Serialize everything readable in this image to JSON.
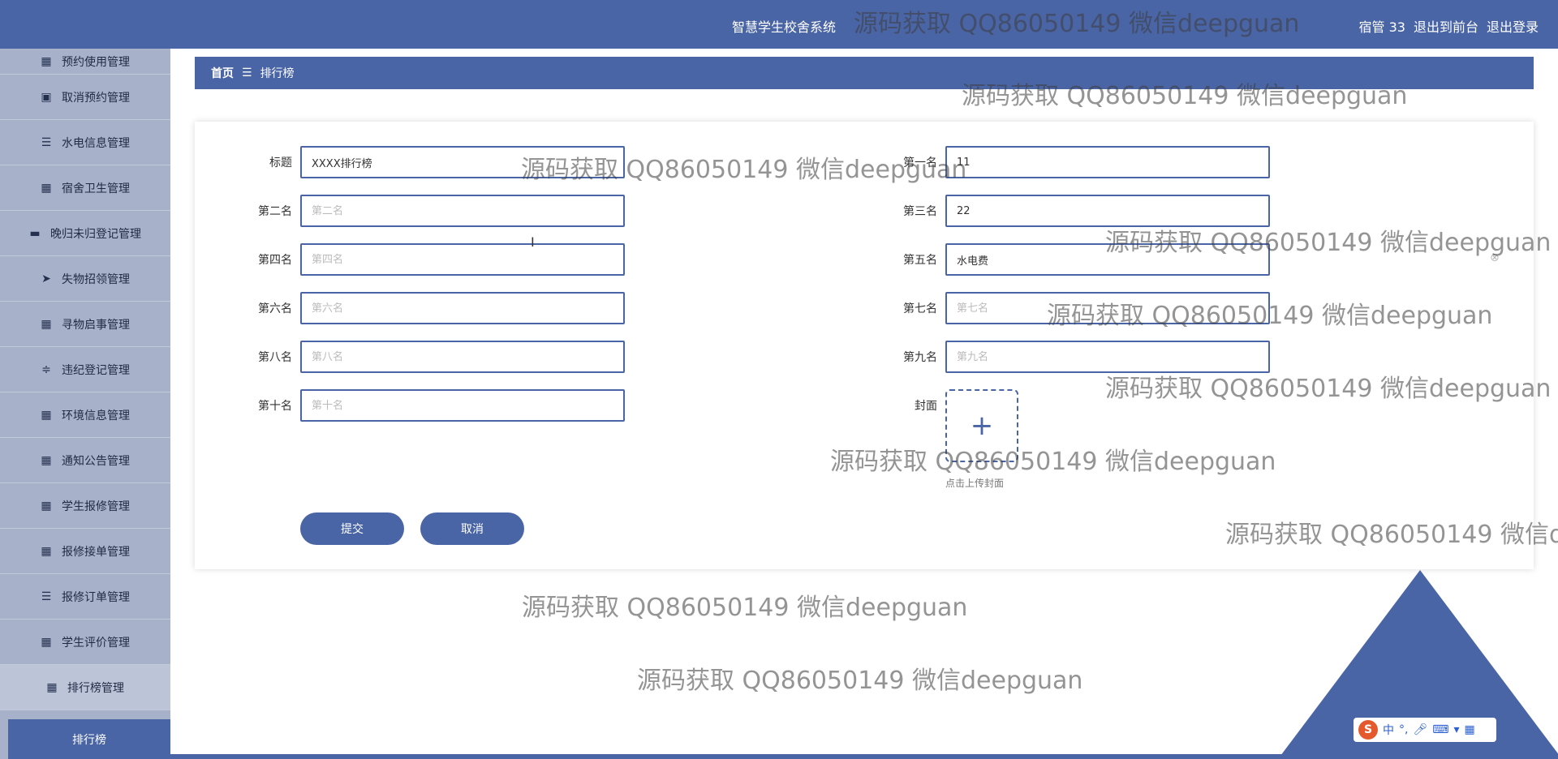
{
  "header": {
    "app_title": "智慧学生校舍系统",
    "user": "宿管 33",
    "exit_front": "退出到前台",
    "logout": "退出登录"
  },
  "sidebar": {
    "items": [
      {
        "label": "预约使用管理",
        "icon": "grid-icon"
      },
      {
        "label": "取消预约管理",
        "icon": "calendar-x-icon"
      },
      {
        "label": "水电信息管理",
        "icon": "list-icon"
      },
      {
        "label": "宿舍卫生管理",
        "icon": "grid-icon"
      },
      {
        "label": "晚归未归登记管理",
        "icon": "briefcase-icon"
      },
      {
        "label": "失物招领管理",
        "icon": "paper-plane-icon"
      },
      {
        "label": "寻物启事管理",
        "icon": "grid-icon"
      },
      {
        "label": "违纪登记管理",
        "icon": "sliders-icon"
      },
      {
        "label": "环境信息管理",
        "icon": "grid-icon"
      },
      {
        "label": "通知公告管理",
        "icon": "grid-icon"
      },
      {
        "label": "学生报修管理",
        "icon": "grid-icon"
      },
      {
        "label": "报修接单管理",
        "icon": "grid-icon"
      },
      {
        "label": "报修订单管理",
        "icon": "list-icon"
      },
      {
        "label": "学生评价管理",
        "icon": "grid-icon"
      },
      {
        "label": "排行榜管理",
        "icon": "grid-icon"
      }
    ],
    "active_sub": "排行榜"
  },
  "breadcrumb": {
    "home": "首页",
    "separator": "☰",
    "current": "排行榜"
  },
  "form": {
    "title": {
      "label": "标题",
      "value": "XXXX排行榜",
      "placeholder": "标题"
    },
    "first": {
      "label": "第一名",
      "value": "11",
      "placeholder": "第一名"
    },
    "second": {
      "label": "第二名",
      "value": "",
      "placeholder": "第二名"
    },
    "third": {
      "label": "第三名",
      "value": "22",
      "placeholder": "第三名"
    },
    "fourth": {
      "label": "第四名",
      "value": "",
      "placeholder": "第四名"
    },
    "fifth": {
      "label": "第五名",
      "value": "水电费",
      "placeholder": "第五名"
    },
    "sixth": {
      "label": "第六名",
      "value": "",
      "placeholder": "第六名"
    },
    "seventh": {
      "label": "第七名",
      "value": "",
      "placeholder": "第七名"
    },
    "eighth": {
      "label": "第八名",
      "value": "",
      "placeholder": "第八名"
    },
    "ninth": {
      "label": "第九名",
      "value": "",
      "placeholder": "第九名"
    },
    "tenth": {
      "label": "第十名",
      "value": "",
      "placeholder": "第十名"
    },
    "cover": {
      "label": "封面",
      "plus": "+",
      "hint": "点击上传封面"
    },
    "submit": "提交",
    "cancel": "取消"
  },
  "ime": {
    "logo": "S",
    "mode": "中",
    "punct": "°,"
  },
  "watermark": "源码获取 QQ86050149 微信deepguan",
  "colors": {
    "primary": "#4a65a5",
    "sidebar": "#a7b1c9"
  }
}
